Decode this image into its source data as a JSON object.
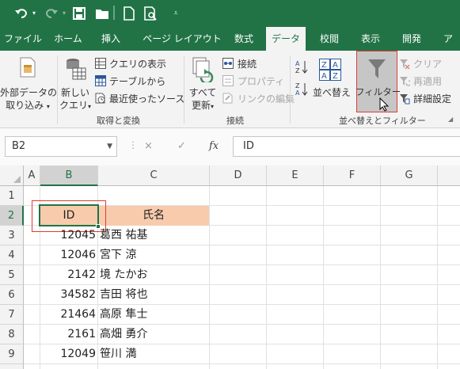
{
  "quick_access": {
    "undo_icon": "undo-icon",
    "redo_icon": "redo-icon",
    "save_icon": "save-icon",
    "open_icon": "open-folder-icon",
    "new_icon": "new-document-icon",
    "print_preview_icon": "print-preview-icon",
    "customize_icon": "customize-qat-icon"
  },
  "tabs": [
    "ファイル",
    "ホーム",
    "挿入",
    "ページ レイアウト",
    "数式",
    "データ",
    "校閲",
    "表示",
    "開発",
    "ア"
  ],
  "active_tab": "データ",
  "ribbon": {
    "get_external_line1": "外部データの",
    "get_external_line2": "取り込み",
    "new_query_line1": "新しい",
    "new_query_line2": "クエリ",
    "show_queries": "クエリの表示",
    "from_table": "テーブルから",
    "recent_sources": "最近使ったソース",
    "group_get_transform": "取得と変換",
    "refresh_all_line1": "すべて",
    "refresh_all_line2": "更新",
    "connections": "接続",
    "properties": "プロパティ",
    "edit_links": "リンクの編集",
    "group_connections": "接続",
    "sort": "並べ替え",
    "filter": "フィルター",
    "clear": "クリア",
    "reapply": "再適用",
    "advanced": "詳細設定",
    "group_sort_filter": "並べ替えとフィルター"
  },
  "formula_bar": {
    "name_box": "B2",
    "cancel_symbol": "×",
    "enter_symbol": "✓",
    "fx_symbol": "fx",
    "content": "ID"
  },
  "grid": {
    "columns": [
      "A",
      "B",
      "C",
      "D",
      "E",
      "F",
      "G"
    ],
    "rows": [
      "1",
      "2",
      "3",
      "4",
      "5",
      "6",
      "7",
      "8",
      "9"
    ],
    "header_row": {
      "b": "ID",
      "c": "氏名"
    },
    "data": [
      {
        "id": "12045",
        "name": "葛西 祐基"
      },
      {
        "id": "12046",
        "name": "宮下 涼"
      },
      {
        "id": "2142",
        "name": "境 たかお"
      },
      {
        "id": "34582",
        "name": "吉田 将也"
      },
      {
        "id": "21464",
        "name": "高原 隼士"
      },
      {
        "id": "2161",
        "name": "高畑 勇介"
      },
      {
        "id": "12049",
        "name": "笹川 満"
      }
    ],
    "header_fill_color": "#f8cbad",
    "selection_color": "#217346",
    "highlight_box_color": "#e03c31"
  }
}
